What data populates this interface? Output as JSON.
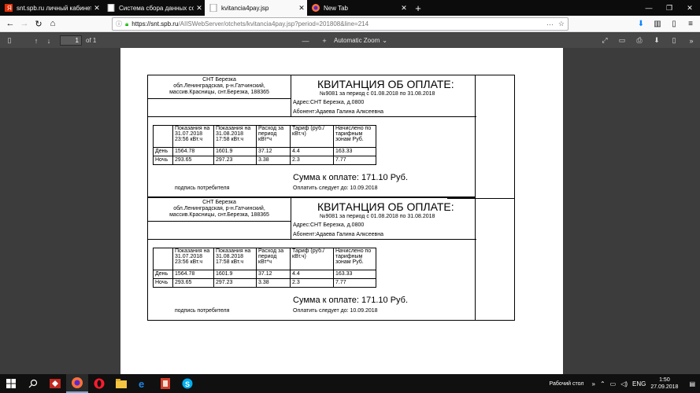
{
  "browser": {
    "tabs": [
      {
        "label": "snt.spb.ru личный кабинет садо",
        "icon": "yandex-icon"
      },
      {
        "label": "Система сбора данных со счетчи",
        "icon": "page-icon"
      },
      {
        "label": "kvitancia4pay.jsp",
        "icon": "page-icon"
      },
      {
        "label": "New Tab",
        "icon": "firefox-icon"
      }
    ],
    "url_prefix": "https://snt.spb.ru",
    "url_rest": "/AIISWebServer/otchets/kvitancia4pay.jsp?period=201808&line=214"
  },
  "pdf_toolbar": {
    "page_number": "1",
    "page_count": "of 1",
    "zoom": "Automatic Zoom"
  },
  "receipts": [
    {
      "org_name": "СНТ Березка",
      "org_addr1": "обл.Ленинградская, р-н.Гатчинский,",
      "org_addr2": "массив.Красницы, снт.Березка, 188365",
      "title": "КВИТАНЦИЯ ОБ ОПЛАТЕ:",
      "period": "№9081 за период с 01.08.2018 по 31.08.2018",
      "address": "Адрес:СНТ Березка, д.0800",
      "subscriber": "Абонент:Адаева Галина Алксеевна",
      "headers": [
        "",
        "Показания на 31.07.2018 23:56 кВт.ч",
        "Показания на 31.08.2018 17:58 кВт.ч",
        "Расход за период кВт*ч",
        "Тариф (руб./кВт.ч)",
        "Начислено по тарифным зонам Руб."
      ],
      "rows": [
        [
          "День",
          "1564.78",
          "1601.9",
          "37.12",
          "4.4",
          "163.33"
        ],
        [
          "Ночь",
          "293.65",
          "297.23",
          "3.38",
          "2.3",
          "7.77"
        ]
      ],
      "sum": "Сумма к оплате: 171.10 Руб.",
      "signature": "подпись потребителя",
      "due": "Оплатить следует до: 10.09.2018"
    },
    {
      "org_name": "СНТ Березка",
      "org_addr1": "обл.Ленинградская, р-н.Гатчинский,",
      "org_addr2": "массив.Красницы, снт.Березка, 188365",
      "title": "КВИТАНЦИЯ ОБ ОПЛАТЕ:",
      "period": "№9081 за период с 01.08.2018 по 31.08.2018",
      "address": "Адрес:СНТ Березка, д.0800",
      "subscriber": "Абонент:Адаева Галина Алксеевна",
      "headers": [
        "",
        "Показания на 31.07.2018 23:56 кВт.ч",
        "Показания на 31.08.2018 17:58 кВт.ч",
        "Расход за период кВт*ч",
        "Тариф (руб./кВт.ч)",
        "Начислено по тарифным зонам Руб."
      ],
      "rows": [
        [
          "День",
          "1564.78",
          "1601.9",
          "37.12",
          "4.4",
          "163.33"
        ],
        [
          "Ночь",
          "293.65",
          "297.23",
          "3.38",
          "2.3",
          "7.77"
        ]
      ],
      "sum": "Сумма к оплате: 171.10 Руб.",
      "signature": "подпись потребителя",
      "due": "Оплатить следует до: 10.09.2018"
    }
  ],
  "taskbar": {
    "desktop_label": "Рабочий стол",
    "lang": "ENG",
    "time": "1:50",
    "date": "27.09.2018"
  }
}
